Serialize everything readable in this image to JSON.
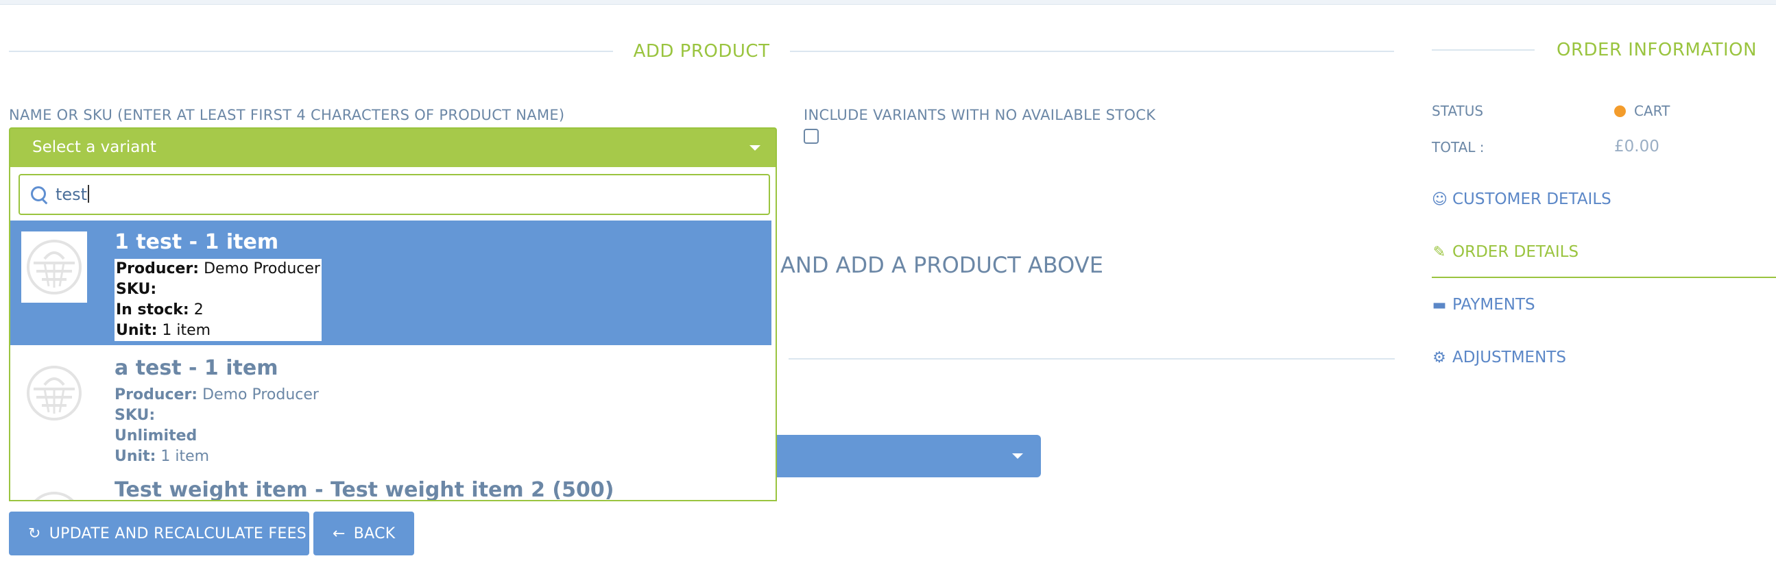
{
  "add_product": {
    "title": "ADD PRODUCT",
    "name_label": "NAME OR SKU (ENTER AT LEAST FIRST 4 CHARACTERS OF PRODUCT NAME)",
    "select_placeholder": "Select a variant",
    "search_value": "test",
    "include_label": "INCLUDE VARIANTS WITH NO AVAILABLE STOCK",
    "include_checked": false,
    "hint_text": "AND ADD A PRODUCT ABOVE",
    "results": [
      {
        "name": "1 test - 1 item",
        "producer_label": "Producer:",
        "producer": "Demo Producer",
        "sku_label": "SKU:",
        "sku": "",
        "stock_label": "In stock:",
        "stock": "2",
        "unit_label": "Unit:",
        "unit": "1 item",
        "highlighted": true
      },
      {
        "name": "a test - 1 item",
        "producer_label": "Producer:",
        "producer": "Demo Producer",
        "sku_label": "SKU:",
        "sku": "",
        "stock_text": "Unlimited",
        "unit_label": "Unit:",
        "unit": "1 item",
        "highlighted": false
      },
      {
        "name": "Test weight item - Test weight item 2 (500)"
      }
    ]
  },
  "buttons": {
    "update": "UPDATE AND RECALCULATE FEES",
    "back": "BACK"
  },
  "order_info": {
    "title": "ORDER INFORMATION",
    "status_label": "STATUS",
    "status_value": "CART",
    "status_color": "#f39c2c",
    "total_label": "TOTAL :",
    "total_value": "£0.00",
    "links": [
      {
        "label": "CUSTOMER DETAILS",
        "icon": "user-icon"
      },
      {
        "label": "ORDER DETAILS",
        "icon": "edit-icon",
        "active": true
      },
      {
        "label": "PAYMENTS",
        "icon": "credit-card-icon"
      },
      {
        "label": "ADJUSTMENTS",
        "icon": "gears-icon"
      }
    ]
  },
  "colors": {
    "accent_green": "#9ac43f",
    "accent_blue": "#6497d6",
    "text": "#6b87a6"
  }
}
